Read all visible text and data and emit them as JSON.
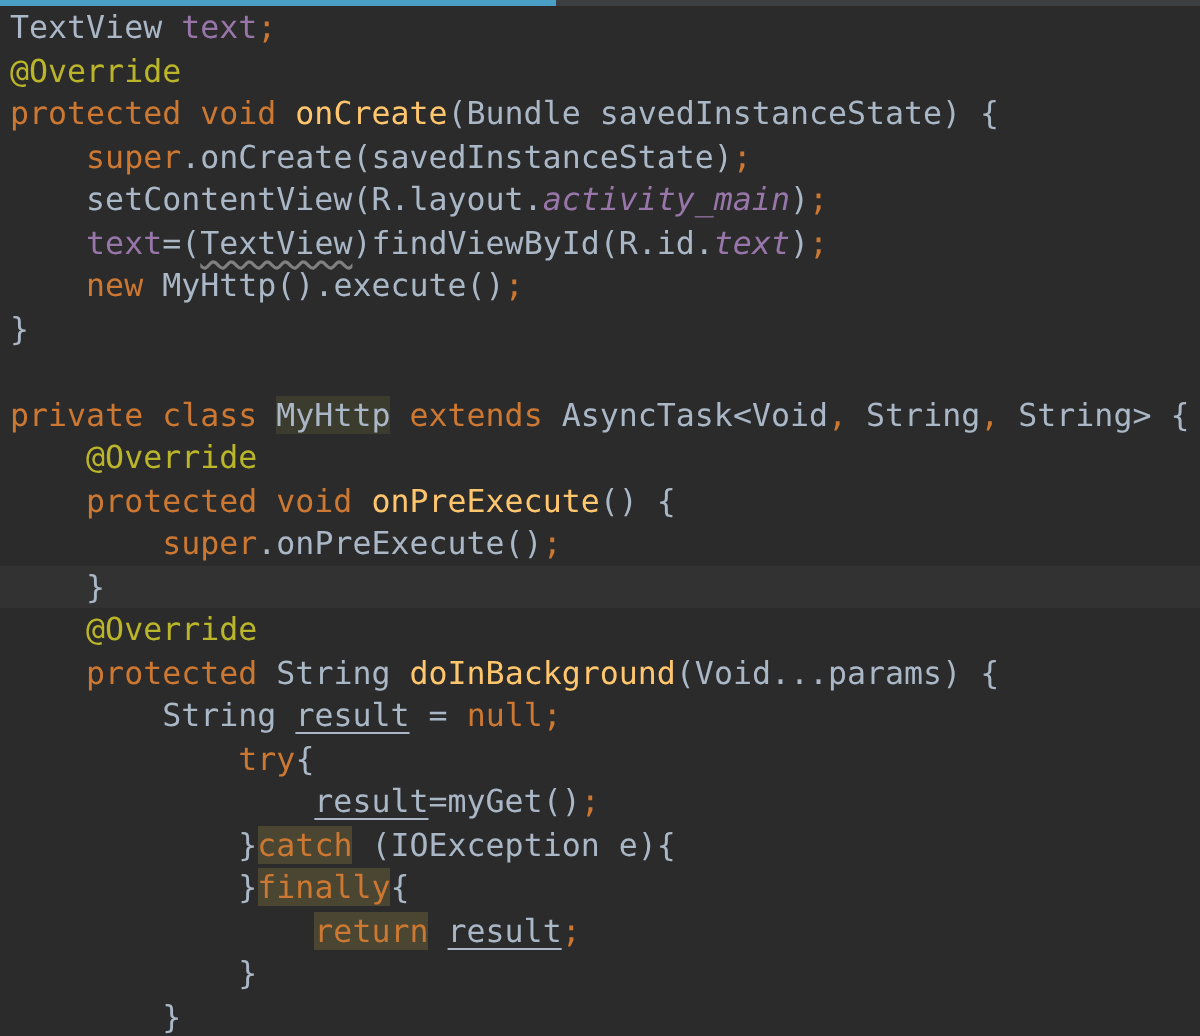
{
  "editor": {
    "lines": [
      {
        "current": false,
        "tokens": [
          {
            "text": "TextView ",
            "kind": "plain"
          },
          {
            "text": "text",
            "kind": "field"
          },
          {
            "text": ";",
            "kind": "keyword"
          }
        ]
      },
      {
        "current": false,
        "tokens": [
          {
            "text": "@Override",
            "kind": "annotation"
          }
        ]
      },
      {
        "current": false,
        "tokens": [
          {
            "text": "protected void ",
            "kind": "keyword"
          },
          {
            "text": "onCreate",
            "kind": "method"
          },
          {
            "text": "(Bundle savedInstanceState) {",
            "kind": "plain"
          }
        ]
      },
      {
        "current": false,
        "tokens": [
          {
            "text": "    super",
            "kind": "keyword"
          },
          {
            "text": ".onCreate(savedInstanceState)",
            "kind": "plain"
          },
          {
            "text": ";",
            "kind": "keyword"
          }
        ]
      },
      {
        "current": false,
        "tokens": [
          {
            "text": "    setContentView(R.layout.",
            "kind": "plain"
          },
          {
            "text": "activity_main",
            "kind": "static"
          },
          {
            "text": ")",
            "kind": "plain"
          },
          {
            "text": ";",
            "kind": "keyword"
          }
        ]
      },
      {
        "current": false,
        "tokens": [
          {
            "text": "    text",
            "kind": "field"
          },
          {
            "text": "=(",
            "kind": "plain"
          },
          {
            "text": "TextView",
            "kind": "warning"
          },
          {
            "text": ")findViewById(R.id.",
            "kind": "plain"
          },
          {
            "text": "text",
            "kind": "static"
          },
          {
            "text": ")",
            "kind": "plain"
          },
          {
            "text": ";",
            "kind": "keyword"
          }
        ]
      },
      {
        "current": false,
        "tokens": [
          {
            "text": "    new ",
            "kind": "keyword"
          },
          {
            "text": "MyHttp().execute()",
            "kind": "plain"
          },
          {
            "text": ";",
            "kind": "keyword"
          }
        ]
      },
      {
        "current": false,
        "tokens": [
          {
            "text": "}",
            "kind": "plain"
          }
        ]
      },
      {
        "current": false
      },
      {
        "current": false,
        "tokens": [
          {
            "text": "private class ",
            "kind": "keyword"
          },
          {
            "text": "MyHttp",
            "kind": "match"
          },
          {
            "text": " extends ",
            "kind": "keyword"
          },
          {
            "text": "AsyncTask<Void",
            "kind": "plain"
          },
          {
            "text": ", ",
            "kind": "keyword"
          },
          {
            "text": "String",
            "kind": "plain"
          },
          {
            "text": ", ",
            "kind": "keyword"
          },
          {
            "text": "String> {",
            "kind": "plain"
          }
        ]
      },
      {
        "current": false,
        "tokens": [
          {
            "text": "    @Override",
            "kind": "annotation"
          }
        ]
      },
      {
        "current": false,
        "tokens": [
          {
            "text": "    protected void ",
            "kind": "keyword"
          },
          {
            "text": "onPreExecute",
            "kind": "method"
          },
          {
            "text": "() {",
            "kind": "plain"
          }
        ]
      },
      {
        "current": false,
        "tokens": [
          {
            "text": "        super",
            "kind": "keyword"
          },
          {
            "text": ".onPreExecute()",
            "kind": "plain"
          },
          {
            "text": ";",
            "kind": "keyword"
          }
        ]
      },
      {
        "current": true,
        "tokens": [
          {
            "text": "    }",
            "kind": "plain"
          }
        ]
      },
      {
        "current": false,
        "tokens": [
          {
            "text": "    @Override",
            "kind": "annotation"
          }
        ]
      },
      {
        "current": false,
        "tokens": [
          {
            "text": "    protected ",
            "kind": "keyword"
          },
          {
            "text": "String ",
            "kind": "plain"
          },
          {
            "text": "doInBackground",
            "kind": "method"
          },
          {
            "text": "(Void...params) {",
            "kind": "plain"
          }
        ]
      },
      {
        "current": false,
        "tokens": [
          {
            "text": "        String ",
            "kind": "plain"
          },
          {
            "text": "result",
            "kind": "local"
          },
          {
            "text": " = ",
            "kind": "plain"
          },
          {
            "text": "null",
            "kind": "keyword"
          },
          {
            "text": ";",
            "kind": "keyword"
          }
        ]
      },
      {
        "current": false,
        "tokens": [
          {
            "text": "            try",
            "kind": "keyword"
          },
          {
            "text": "{",
            "kind": "plain"
          }
        ]
      },
      {
        "current": false,
        "tokens": [
          {
            "text": "                result",
            "kind": "local"
          },
          {
            "text": "=myGet()",
            "kind": "plain"
          },
          {
            "text": ";",
            "kind": "keyword"
          }
        ]
      },
      {
        "current": false,
        "tokens": [
          {
            "text": "            }",
            "kind": "plain"
          },
          {
            "text": "catch",
            "kind": "keyword-match"
          },
          {
            "text": " (IOException e){",
            "kind": "plain"
          }
        ]
      },
      {
        "current": false,
        "tokens": [
          {
            "text": "            }",
            "kind": "plain"
          },
          {
            "text": "finally",
            "kind": "keyword-match"
          },
          {
            "text": "{",
            "kind": "plain"
          }
        ]
      },
      {
        "current": false,
        "tokens": [
          {
            "text": "                return",
            "kind": "keyword-match"
          },
          {
            "text": " result",
            "kind": "local"
          },
          {
            "text": ";",
            "kind": "keyword"
          }
        ]
      },
      {
        "current": false,
        "tokens": [
          {
            "text": "            }",
            "kind": "plain"
          }
        ]
      },
      {
        "current": false,
        "tokens": [
          {
            "text": "        }",
            "kind": "plain"
          }
        ]
      }
    ]
  }
}
